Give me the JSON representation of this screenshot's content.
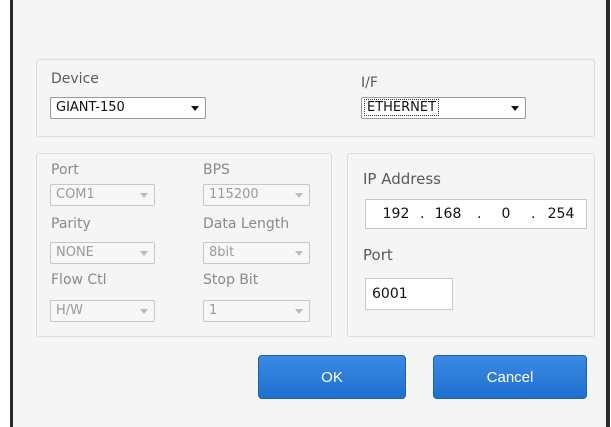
{
  "device": {
    "label": "Device",
    "value": "GIANT-150"
  },
  "interface": {
    "label": "I/F",
    "value": "ETHERNET"
  },
  "serial": {
    "port_label": "Port",
    "port_value": "COM1",
    "bps_label": "BPS",
    "bps_value": "115200",
    "parity_label": "Parity",
    "parity_value": "NONE",
    "data_length_label": "Data Length",
    "data_length_value": "8bit",
    "flow_label": "Flow Ctl",
    "flow_value": "H/W",
    "stop_bit_label": "Stop Bit",
    "stop_bit_value": "1"
  },
  "network": {
    "ip_label": "IP Address",
    "ip_parts": [
      "192",
      "168",
      "0",
      "254"
    ],
    "port_label": "Port",
    "port_value": "6001"
  },
  "buttons": {
    "ok": "OK",
    "cancel": "Cancel"
  },
  "colors": {
    "button_blue": "#2a7ad9",
    "panel_bg": "#f5f5f5"
  }
}
